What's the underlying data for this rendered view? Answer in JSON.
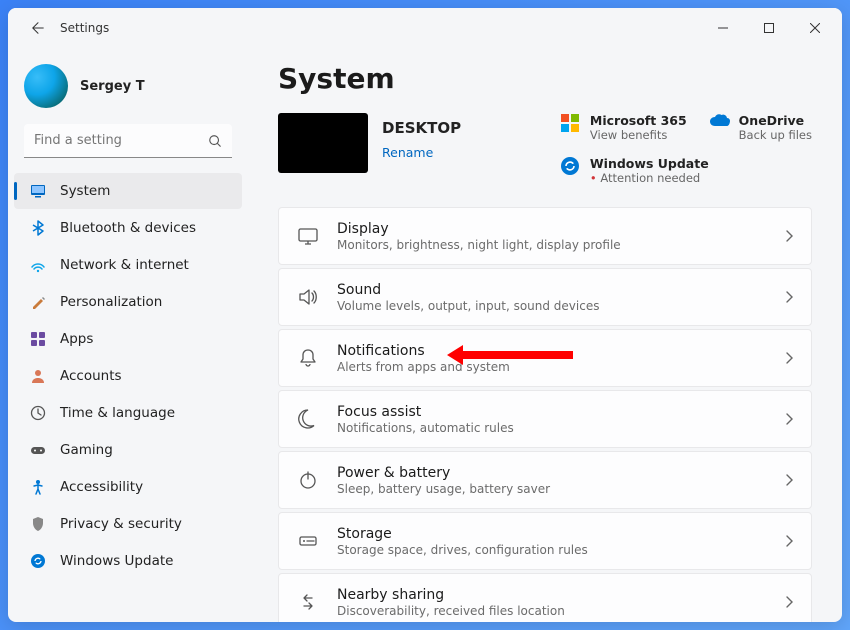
{
  "window": {
    "title": "Settings"
  },
  "user": {
    "name": "Sergey T"
  },
  "search": {
    "placeholder": "Find a setting"
  },
  "nav": {
    "items": [
      {
        "label": "System",
        "icon": "system"
      },
      {
        "label": "Bluetooth & devices",
        "icon": "bluetooth"
      },
      {
        "label": "Network & internet",
        "icon": "network"
      },
      {
        "label": "Personalization",
        "icon": "personalization"
      },
      {
        "label": "Apps",
        "icon": "apps"
      },
      {
        "label": "Accounts",
        "icon": "accounts"
      },
      {
        "label": "Time & language",
        "icon": "time"
      },
      {
        "label": "Gaming",
        "icon": "gaming"
      },
      {
        "label": "Accessibility",
        "icon": "accessibility"
      },
      {
        "label": "Privacy & security",
        "icon": "privacy"
      },
      {
        "label": "Windows Update",
        "icon": "update"
      }
    ],
    "active_index": 0
  },
  "page": {
    "title": "System",
    "device_name": "DESKTOP",
    "rename_label": "Rename"
  },
  "promos": {
    "ms365": {
      "title": "Microsoft 365",
      "sub": "View benefits"
    },
    "onedrive": {
      "title": "OneDrive",
      "sub": "Back up files"
    },
    "update": {
      "title": "Windows Update",
      "sub": "Attention needed"
    }
  },
  "settings": [
    {
      "title": "Display",
      "desc": "Monitors, brightness, night light, display profile"
    },
    {
      "title": "Sound",
      "desc": "Volume levels, output, input, sound devices"
    },
    {
      "title": "Notifications",
      "desc": "Alerts from apps and system"
    },
    {
      "title": "Focus assist",
      "desc": "Notifications, automatic rules"
    },
    {
      "title": "Power & battery",
      "desc": "Sleep, battery usage, battery saver"
    },
    {
      "title": "Storage",
      "desc": "Storage space, drives, configuration rules"
    },
    {
      "title": "Nearby sharing",
      "desc": "Discoverability, received files location"
    }
  ]
}
